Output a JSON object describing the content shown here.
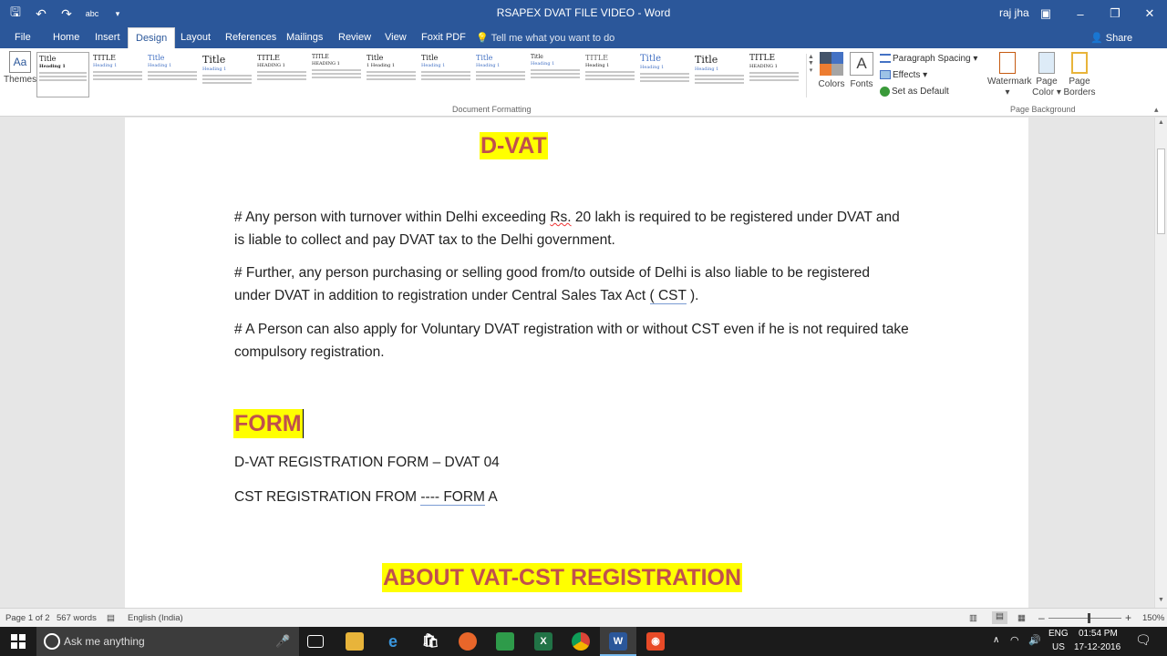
{
  "titlebar": {
    "title": "RSAPEX DVAT FILE VIDEO  -  Word",
    "user": "raj jha",
    "qat_icons": [
      "save-icon",
      "undo-icon",
      "redo-icon",
      "spelling-icon",
      "customize-icon"
    ]
  },
  "tabs": [
    "File",
    "Home",
    "Insert",
    "Design",
    "Layout",
    "References",
    "Mailings",
    "Review",
    "View",
    "Foxit PDF"
  ],
  "active_tab": "Design",
  "tell_me": "Tell me what you want to do",
  "share": "Share",
  "ribbon": {
    "themes": "Themes",
    "style_set": [
      {
        "title": "Title",
        "heading": "Heading 1"
      },
      {
        "title": "TITLE",
        "heading": "Heading 1"
      },
      {
        "title": "Title",
        "heading": "Heading 1"
      },
      {
        "title": "Title",
        "heading": "Heading 1"
      },
      {
        "title": "TITLE",
        "heading": "HEADING 1"
      },
      {
        "title": "TITLE",
        "heading": "HEADING 1"
      },
      {
        "title": "Title",
        "heading": "1  Heading 1"
      },
      {
        "title": "Title",
        "heading": "Heading 1"
      },
      {
        "title": "Title",
        "heading": "Heading 1"
      },
      {
        "title": "Title",
        "heading": "Heading 1"
      },
      {
        "title": "TITLE",
        "heading": "Heading 1"
      },
      {
        "title": "Title",
        "heading": "Heading 1"
      },
      {
        "title": "Title",
        "heading": "Heading 1"
      },
      {
        "title": "Title",
        "heading": "Heading 1"
      },
      {
        "title": "TITLE",
        "heading": "HEADING 1"
      }
    ],
    "document_formatting": "Document Formatting",
    "colors": "Colors",
    "fonts": "Fonts",
    "fonts_glyph": "A",
    "paragraph_spacing": "Paragraph Spacing",
    "effects": "Effects",
    "set_as_default": "Set as Default",
    "watermark": "Watermark",
    "page_color_1": "Page",
    "page_color_2": "Color",
    "page_borders_1": "Page",
    "page_borders_2": "Borders",
    "page_background": "Page Background"
  },
  "document": {
    "heading_dvat": "D-VAT",
    "para1_a": "# Any person with turnover within Delhi exceeding ",
    "para1_rs": "Rs.",
    "para1_b": " 20 lakh is required to be registered under DVAT and is liable to collect and pay DVAT tax to the Delhi government.",
    "para2_a": "# Further, any person purchasing or selling good from/to outside of Delhi is also liable to be registered under DVAT in addition to registration under Central Sales Tax Act ",
    "para2_cst": "( CST",
    "para2_b": " ).",
    "para3": "# A Person can also apply for Voluntary DVAT registration with or without CST even if he is not required take compulsory registration.",
    "heading_form": "FORM",
    "line1": "D-VAT REGISTRATION FORM – DVAT 04",
    "line2_a": "CST REGISTRATION FROM ",
    "line2_b": "----  FORM",
    "line2_c": " A",
    "heading_about": "ABOUT VAT-CST REGISTRATION"
  },
  "status": {
    "page": "Page 1 of 2",
    "words": "567 words",
    "language": "English (India)",
    "zoom": "150%",
    "zoom_minus": "–",
    "zoom_plus": "+"
  },
  "taskbar": {
    "search": "Ask me anything",
    "lang1": "ENG",
    "lang2": "US",
    "time": "01:54 PM",
    "date": "17-12-2016"
  },
  "colors": {
    "word_blue": "#2b579a",
    "highlight": "#ffff00",
    "heading_red": "#c0504d"
  }
}
